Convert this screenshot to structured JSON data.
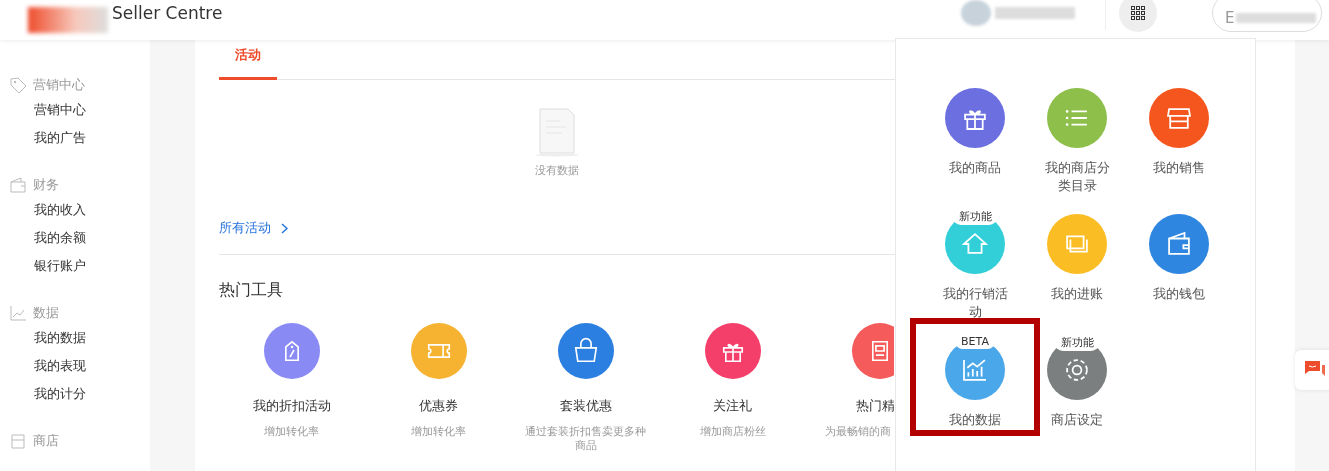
{
  "topbar": {
    "title": "Seller Centre",
    "account_button": "E"
  },
  "sidebar": {
    "sections": [
      {
        "title": "营销中心",
        "items": [
          "营销中心",
          "我的广告"
        ]
      },
      {
        "title": "财务",
        "items": [
          "我的收入",
          "我的余额",
          "银行账户"
        ]
      },
      {
        "title": "数据",
        "items": [
          "我的数据",
          "我的表现",
          "我的计分"
        ]
      },
      {
        "title": "商店"
      }
    ]
  },
  "activity": {
    "tabs": [
      {
        "label": "活动",
        "selected": true
      }
    ],
    "empty_text": "没有数据",
    "all_link": "所有活动"
  },
  "tools": {
    "title": "热门工具",
    "items": [
      {
        "name": "我的折扣活动",
        "desc": "增加转化率",
        "color": "#8a8af5"
      },
      {
        "name": "优惠券",
        "desc": "增加转化率",
        "color": "#f6b332"
      },
      {
        "name": "套装优惠",
        "desc": "通过套装折扣售卖更多种商品",
        "color": "#2b7fe0"
      },
      {
        "name": "关注礼",
        "desc": "增加商店粉丝",
        "color": "#f43f6b"
      },
      {
        "name": "热门精",
        "desc": "为最畅销的商",
        "color": "#f55b5b"
      }
    ]
  },
  "apps_panel": {
    "items": [
      {
        "label": "我的商品",
        "color": "#6b6fe0",
        "highlighted": false
      },
      {
        "label": "我的商店分类目录",
        "color": "#8dbf4a",
        "highlighted": false
      },
      {
        "label": "我的销售",
        "color": "#f5561e",
        "highlighted": false
      },
      {
        "label": "我的行销活动",
        "color": "#33cfd9",
        "badge": "新功能",
        "highlighted": false
      },
      {
        "label": "我的进账",
        "color": "#fbbd24",
        "highlighted": false
      },
      {
        "label": "我的钱包",
        "color": "#2f86e0",
        "highlighted": false
      },
      {
        "label": "我的数据",
        "color": "#4aa8ea",
        "badge": "BETA",
        "highlighted": true
      },
      {
        "label": "商店设定",
        "color": "#7b7f80",
        "badge": "新功能",
        "highlighted": false
      }
    ]
  }
}
